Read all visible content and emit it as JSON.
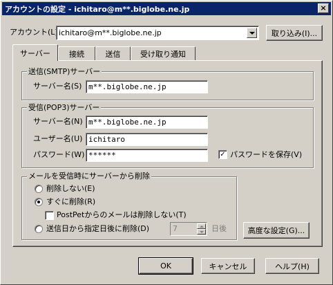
{
  "window": {
    "title": "アカウントの設定 - ichitaro@m**.biglobe.ne.jp",
    "close_glyph": "×"
  },
  "account": {
    "label": "アカウント(L)",
    "selected": "ichitaro@m**.biglobe.ne.jp",
    "import_button": "取り込み(I)..."
  },
  "tabs": [
    {
      "label": "サーバー",
      "active": true
    },
    {
      "label": "接続",
      "active": false
    },
    {
      "label": "送信",
      "active": false
    },
    {
      "label": "受け取り通知",
      "active": false
    }
  ],
  "smtp": {
    "group_title": "送信(SMTP)サーバー",
    "server_label": "サーバー名(S)",
    "server_value": "m**.biglobe.ne.jp"
  },
  "pop3": {
    "group_title": "受信(POP3)サーバー",
    "server_label": "サーバー名(N)",
    "server_value": "m**.biglobe.ne.jp",
    "user_label": "ユーザー名(U)",
    "user_value": "ichitaro",
    "password_label": "パスワード(W)",
    "password_value": "******",
    "save_password_label": "パスワードを保存(V)",
    "save_password_checked": true,
    "check_glyph": "✓"
  },
  "delete": {
    "group_title": "メールを受信時にサーバーから削除",
    "opt_none": "削除しない(E)",
    "opt_now": "すぐに削除(R)",
    "opt_postpet": "PostPetからのメールは削除しない(T)",
    "opt_days": "送信日から指定日後に削除(D)",
    "days_value": "7",
    "days_unit": "日後",
    "selected": "now",
    "postpet_checked": false
  },
  "advanced_button": "高度な設定(G)...",
  "footer": {
    "ok": "OK",
    "cancel": "キャンセル",
    "help": "ヘルプ(H)"
  }
}
